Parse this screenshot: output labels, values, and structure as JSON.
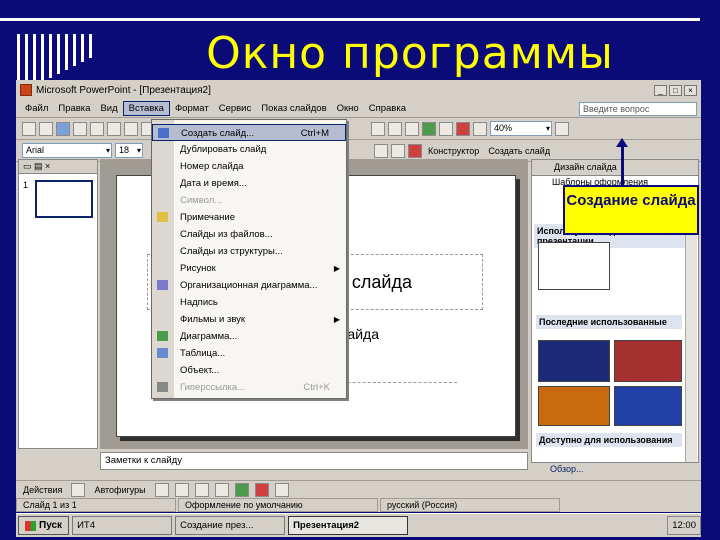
{
  "slide": {
    "title": "Окно программы"
  },
  "window": {
    "title": "Microsoft PowerPoint - [Презентация2]",
    "ask_placeholder": "Введите вопрос",
    "menu": [
      "Файл",
      "Правка",
      "Вид",
      "Вставка",
      "Формат",
      "Сервис",
      "Показ слайдов",
      "Окно",
      "Справка"
    ],
    "active_menu_index": 3,
    "zoom": "40%",
    "font_name": "Arial",
    "font_size": "18",
    "constructor_label": "Конструктор",
    "create_slide_label": "Создать слайд"
  },
  "dropdown": {
    "items": [
      {
        "label": "Создать слайд...",
        "shortcut": "Ctrl+M",
        "highlight": true
      },
      {
        "label": "Дублировать слайд"
      },
      {
        "label": "Номер слайда"
      },
      {
        "label": "Дата и время..."
      },
      {
        "label": "Символ...",
        "disabled": true
      },
      {
        "label": "Примечание"
      },
      {
        "label": "Слайды из файлов..."
      },
      {
        "label": "Слайды из структуры..."
      },
      {
        "label": "Рисунок",
        "submenu": true
      },
      {
        "label": "Организационная диаграмма..."
      },
      {
        "label": "Надпись"
      },
      {
        "label": "Фильмы и звук",
        "submenu": true
      },
      {
        "label": "Диаграмма..."
      },
      {
        "label": "Таблица..."
      },
      {
        "label": "Объект..."
      },
      {
        "label": "Гиперссылка...",
        "shortcut": "Ctrl+K",
        "disabled": true
      }
    ]
  },
  "left_pane": {
    "slide_number": "1"
  },
  "edit": {
    "title_placeholder": "слайда",
    "subtitle_placeholder": "слайда",
    "notes": "Заметки к слайду"
  },
  "task_pane": {
    "header": "Дизайн слайда",
    "links": [
      "Шаблоны оформления"
    ],
    "section_used": "Используется в данной презентации",
    "section_recent": "Последние использованные",
    "section_available": "Доступно для использования",
    "browse_link": "Обзор..."
  },
  "draw_toolbar": {
    "actions": "Действия",
    "autoshapes": "Автофигуры"
  },
  "status": {
    "slide": "Слайд 1 из 1",
    "design": "Оформление по умолчанию",
    "language": "русский (Россия)"
  },
  "taskbar": {
    "start": "Пуск",
    "buttons": [
      "ИТ4",
      "Создание през...",
      "Презентация2"
    ],
    "pressed_index": 2,
    "clock": "12:00"
  },
  "callout": {
    "text": "Создание слайда"
  },
  "colors": {
    "background": "#0a0a78",
    "title": "#ffff00",
    "callout": "#ffff00"
  }
}
